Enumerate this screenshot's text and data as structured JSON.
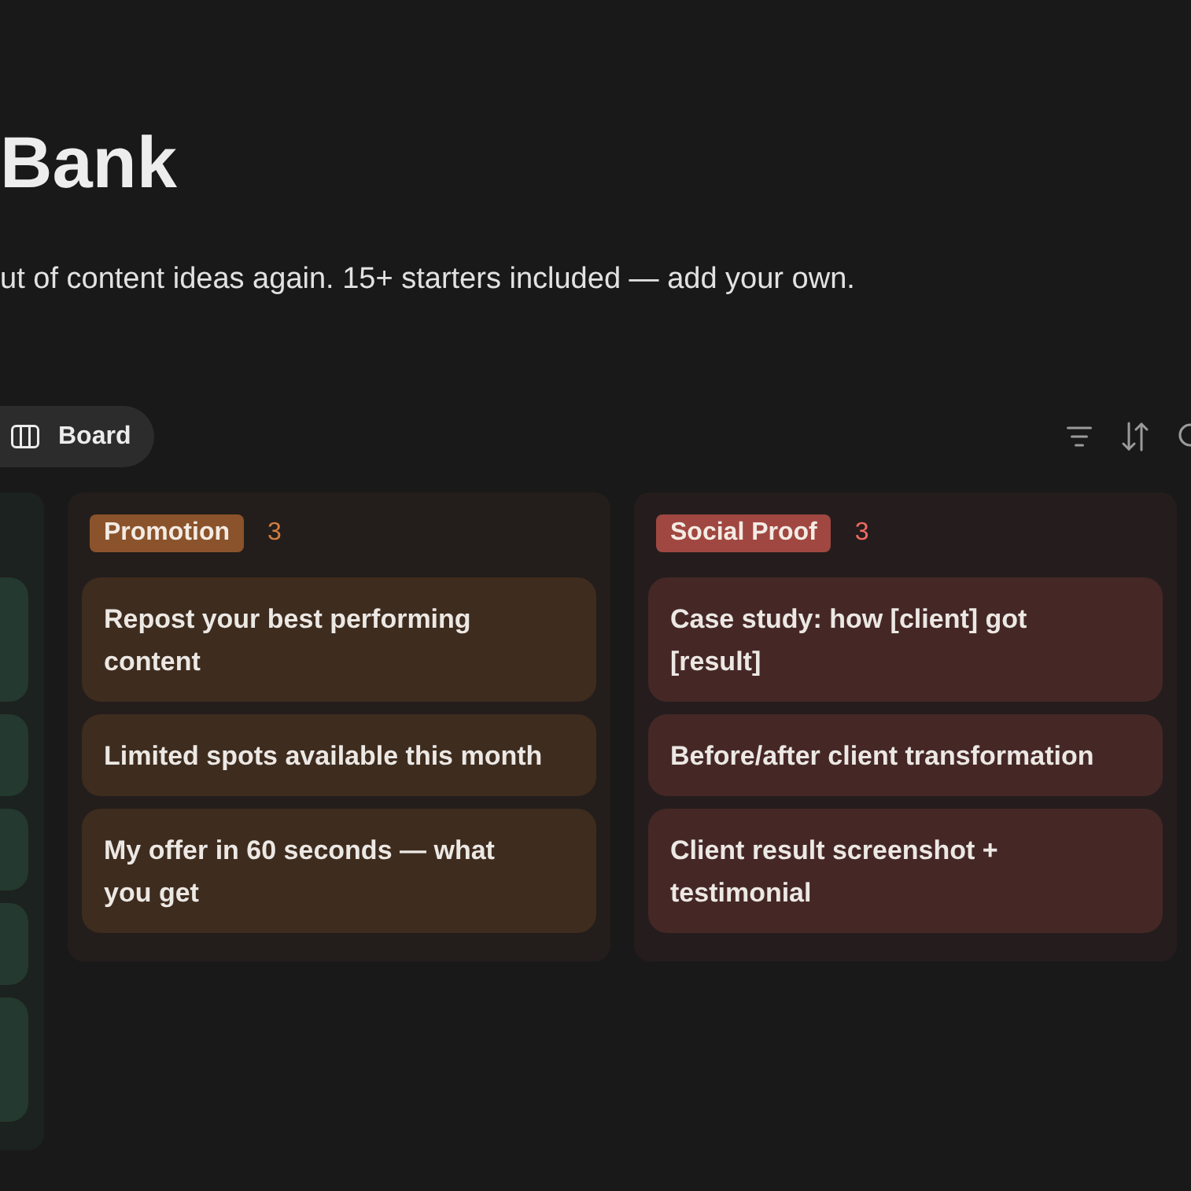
{
  "page": {
    "title": "Bank",
    "description": "ut of content ideas again. 15+ starters included — add your own."
  },
  "views": [
    {
      "label": "Board",
      "selected": true
    }
  ],
  "board": {
    "columns": [
      {
        "kind": "clipped",
        "color": "#24392f",
        "cards": [
          {
            "kind": "two_line"
          },
          {
            "kind": "one_line"
          },
          {
            "kind": "one_line"
          },
          {
            "kind": "one_line"
          },
          {
            "kind": "two_line"
          }
        ]
      },
      {
        "kind": "full",
        "name": "Promotion",
        "count": "3",
        "color": "#3e2c1f",
        "cards": [
          {
            "title": "Repost your best performing content"
          },
          {
            "title": "Limited spots available this month"
          },
          {
            "title": "My offer in 60 seconds — what you get"
          }
        ]
      },
      {
        "kind": "full",
        "name": "Social Proof",
        "count": "3",
        "color": "#452826",
        "cards": [
          {
            "title": "Case study: how [client] got [result]"
          },
          {
            "title": "Before/after client transformation"
          },
          {
            "title": "Client result screenshot + testimonial"
          }
        ]
      }
    ]
  }
}
